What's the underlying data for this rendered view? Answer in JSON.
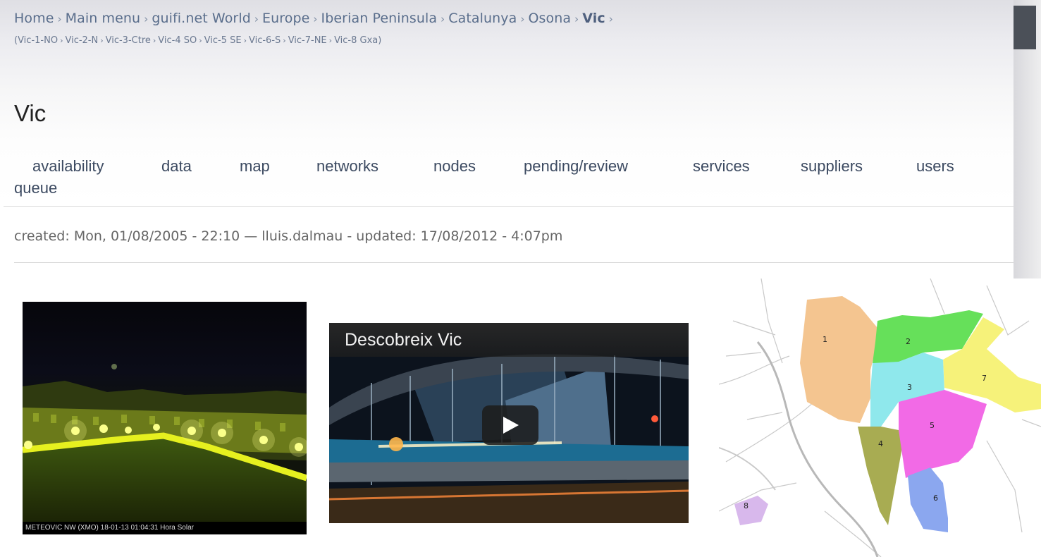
{
  "breadcrumb": {
    "items": [
      "Home",
      "Main menu",
      "guifi.net World",
      "Europe",
      "Iberian Peninsula",
      "Catalunya",
      "Osona"
    ],
    "current": "Vic",
    "separator": "›"
  },
  "subzones": {
    "open": "(",
    "items": [
      "Vic-1-NO",
      "Vic-2-N",
      "Vic-3-Ctre",
      "Vic-4 SO",
      "Vic-5 SE",
      "Vic-6-S",
      "Vic-7-NE"
    ],
    "last": "Vic-8 Gxa",
    "close": ")"
  },
  "page": {
    "title": "Vic"
  },
  "tabs": [
    {
      "label": "availability"
    },
    {
      "label": "data"
    },
    {
      "label": "map"
    },
    {
      "label": "networks"
    },
    {
      "label": "nodes"
    },
    {
      "label": "pending/review"
    },
    {
      "label": "services"
    },
    {
      "label": "suppliers"
    },
    {
      "label": "users"
    },
    {
      "label": "queue"
    }
  ],
  "meta": {
    "created_label": "created:",
    "created": "Mon, 01/08/2005 - 22:10",
    "dash": "—",
    "author": "lluis.dalmau",
    "updated_label": "- updated:",
    "updated": "17/08/2012 - 4:07pm"
  },
  "webcam": {
    "caption": "METEOVIC NW  (XMO) 18-01-13 01:04:31  Hora Solar"
  },
  "video": {
    "title": "Descobreix Vic",
    "play_icon": "play-icon"
  },
  "district_map": {
    "zones": [
      {
        "label": "1",
        "color": "#f4c590"
      },
      {
        "label": "2",
        "color": "#66e05a"
      },
      {
        "label": "3",
        "color": "#8fe8ec"
      },
      {
        "label": "4",
        "color": "#a8ac52"
      },
      {
        "label": "5",
        "color": "#f26ae6"
      },
      {
        "label": "6",
        "color": "#8ba7ef"
      },
      {
        "label": "7",
        "color": "#f6f27a"
      },
      {
        "label": "8",
        "color": "#d8b8ec"
      }
    ]
  },
  "colors": {
    "link": "#5a6e8c",
    "title": "#222222",
    "tab": "#3c4a61",
    "meta": "#666666"
  }
}
